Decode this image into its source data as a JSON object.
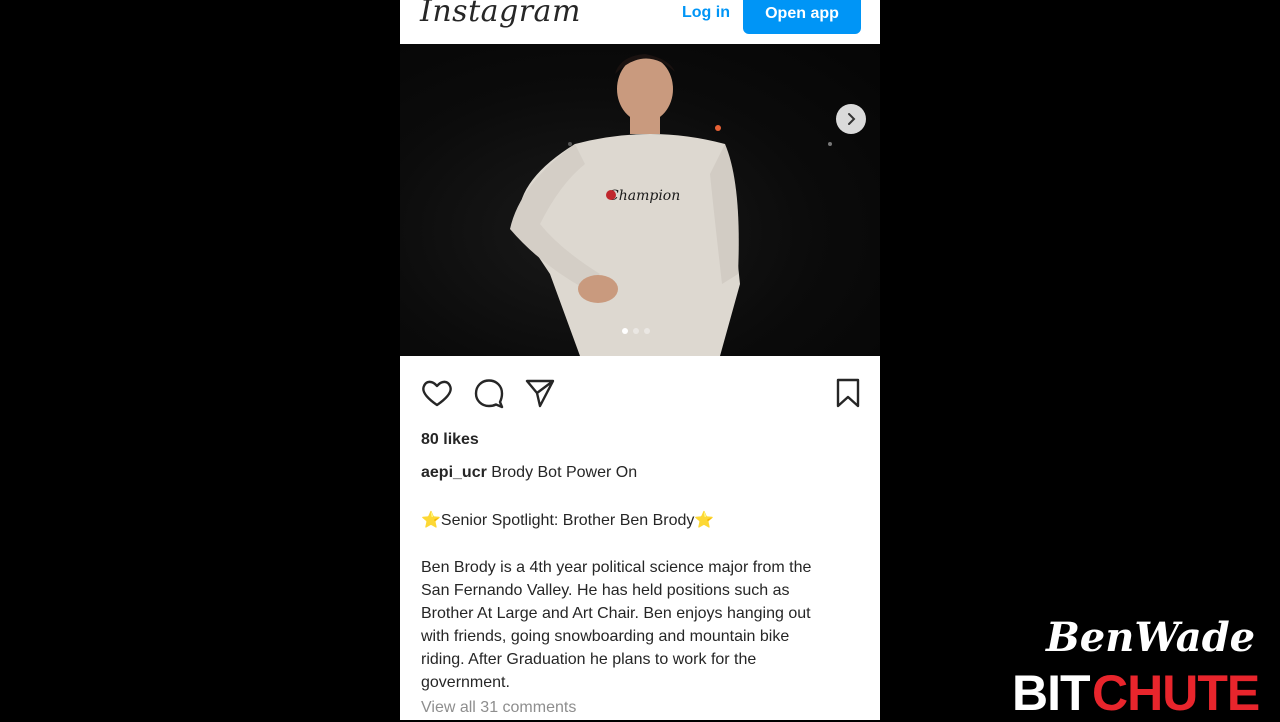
{
  "header": {
    "logo_text": "Instagram",
    "login_label": "Log in",
    "open_app_label": "Open app"
  },
  "post": {
    "carousel": {
      "slide_count": 3,
      "current_slide": 1
    },
    "likes": "80 likes",
    "username": "aepi_ucr",
    "caption": "Brody Bot Power On",
    "spotlight": "⭐Senior Spotlight: Brother Ben Brody⭐",
    "body_lines": [
      "Ben Brody is a 4th year political science major from the",
      "San Fernando Valley. He has held positions such as",
      "Brother At Large and Art Chair. Ben enjoys hanging out",
      "with friends, going snowboarding and mountain bike",
      "riding. After Graduation he plans to work for the",
      "government."
    ],
    "view_comments": "View all 31 comments"
  },
  "icons": {
    "like": "heart-icon",
    "comment": "comment-icon",
    "share": "send-icon",
    "save": "bookmark-icon",
    "next": "chevron-right-icon"
  },
  "watermark": {
    "name": "BenWade",
    "brand_left": "BIT",
    "brand_right": "CHUTE"
  },
  "colors": {
    "accent": "#0095f6",
    "text": "#262626",
    "muted": "#8e8e8e",
    "brand_red": "#e8252c"
  }
}
